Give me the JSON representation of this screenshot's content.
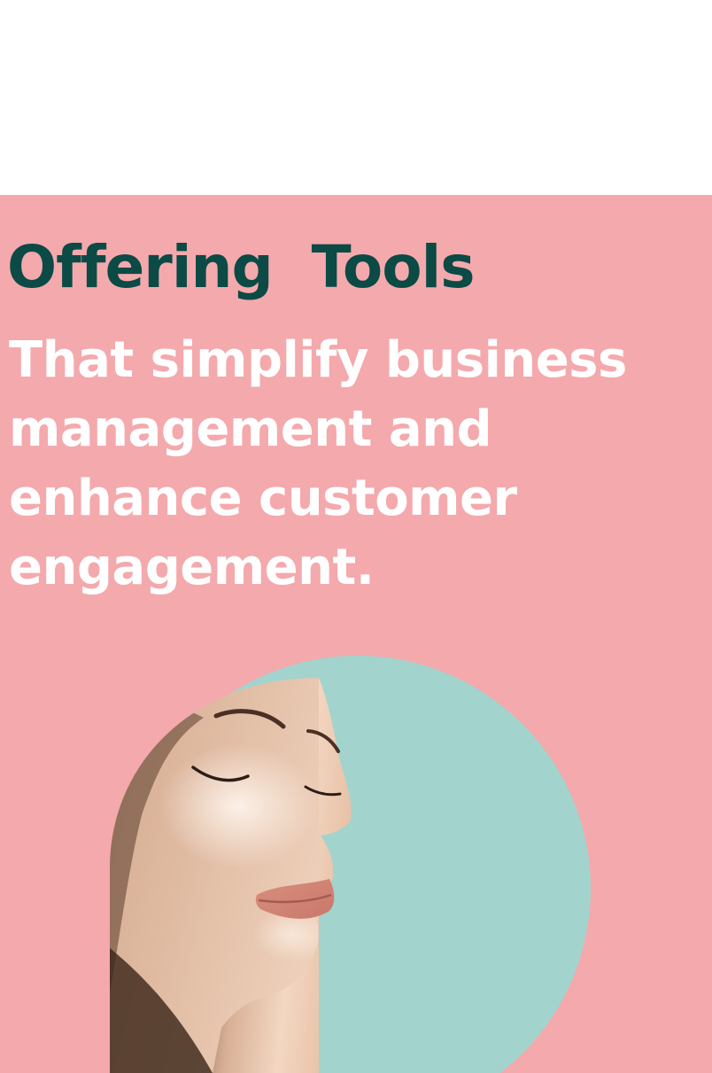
{
  "colors": {
    "background_pink": "#f4a9ad",
    "heading_green": "#0b4a45",
    "text_white": "#ffffff",
    "circle_mint": "#a3d3cd"
  },
  "hero": {
    "eyebrow": "Offering  Tools",
    "headline": "That simplify business management and enhance customer engagement."
  },
  "image": {
    "subject": "woman-face-profile-photo"
  }
}
